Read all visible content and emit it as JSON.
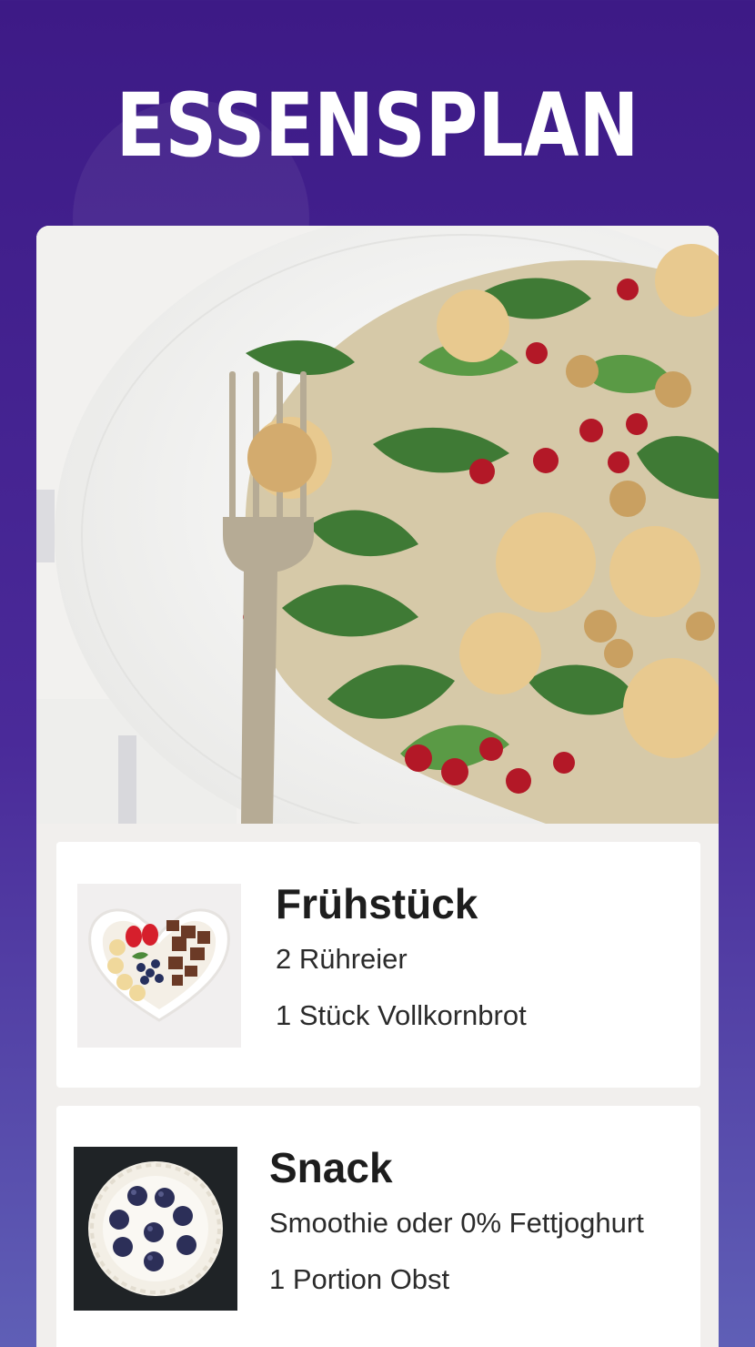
{
  "header": {
    "title": "ESSENSPLAN"
  },
  "hero_image": {
    "icon": "salad-plate-photo"
  },
  "meals": [
    {
      "name": "Frühstück",
      "thumbnail": "yogurt-bowl-photo",
      "items": [
        "2 Rühreier",
        "1 Stück Vollkornbrot"
      ]
    },
    {
      "name": "Snack",
      "thumbnail": "blueberries-bowl-photo",
      "items": [
        "Smoothie oder 0% Fettjoghurt",
        "1 Portion Obst"
      ]
    }
  ],
  "colors": {
    "background_top": "#3d1a86",
    "background_bottom": "#5f5fb6",
    "card": "#f1efed",
    "meal_card": "#ffffff",
    "text": "#1d1d1d"
  }
}
